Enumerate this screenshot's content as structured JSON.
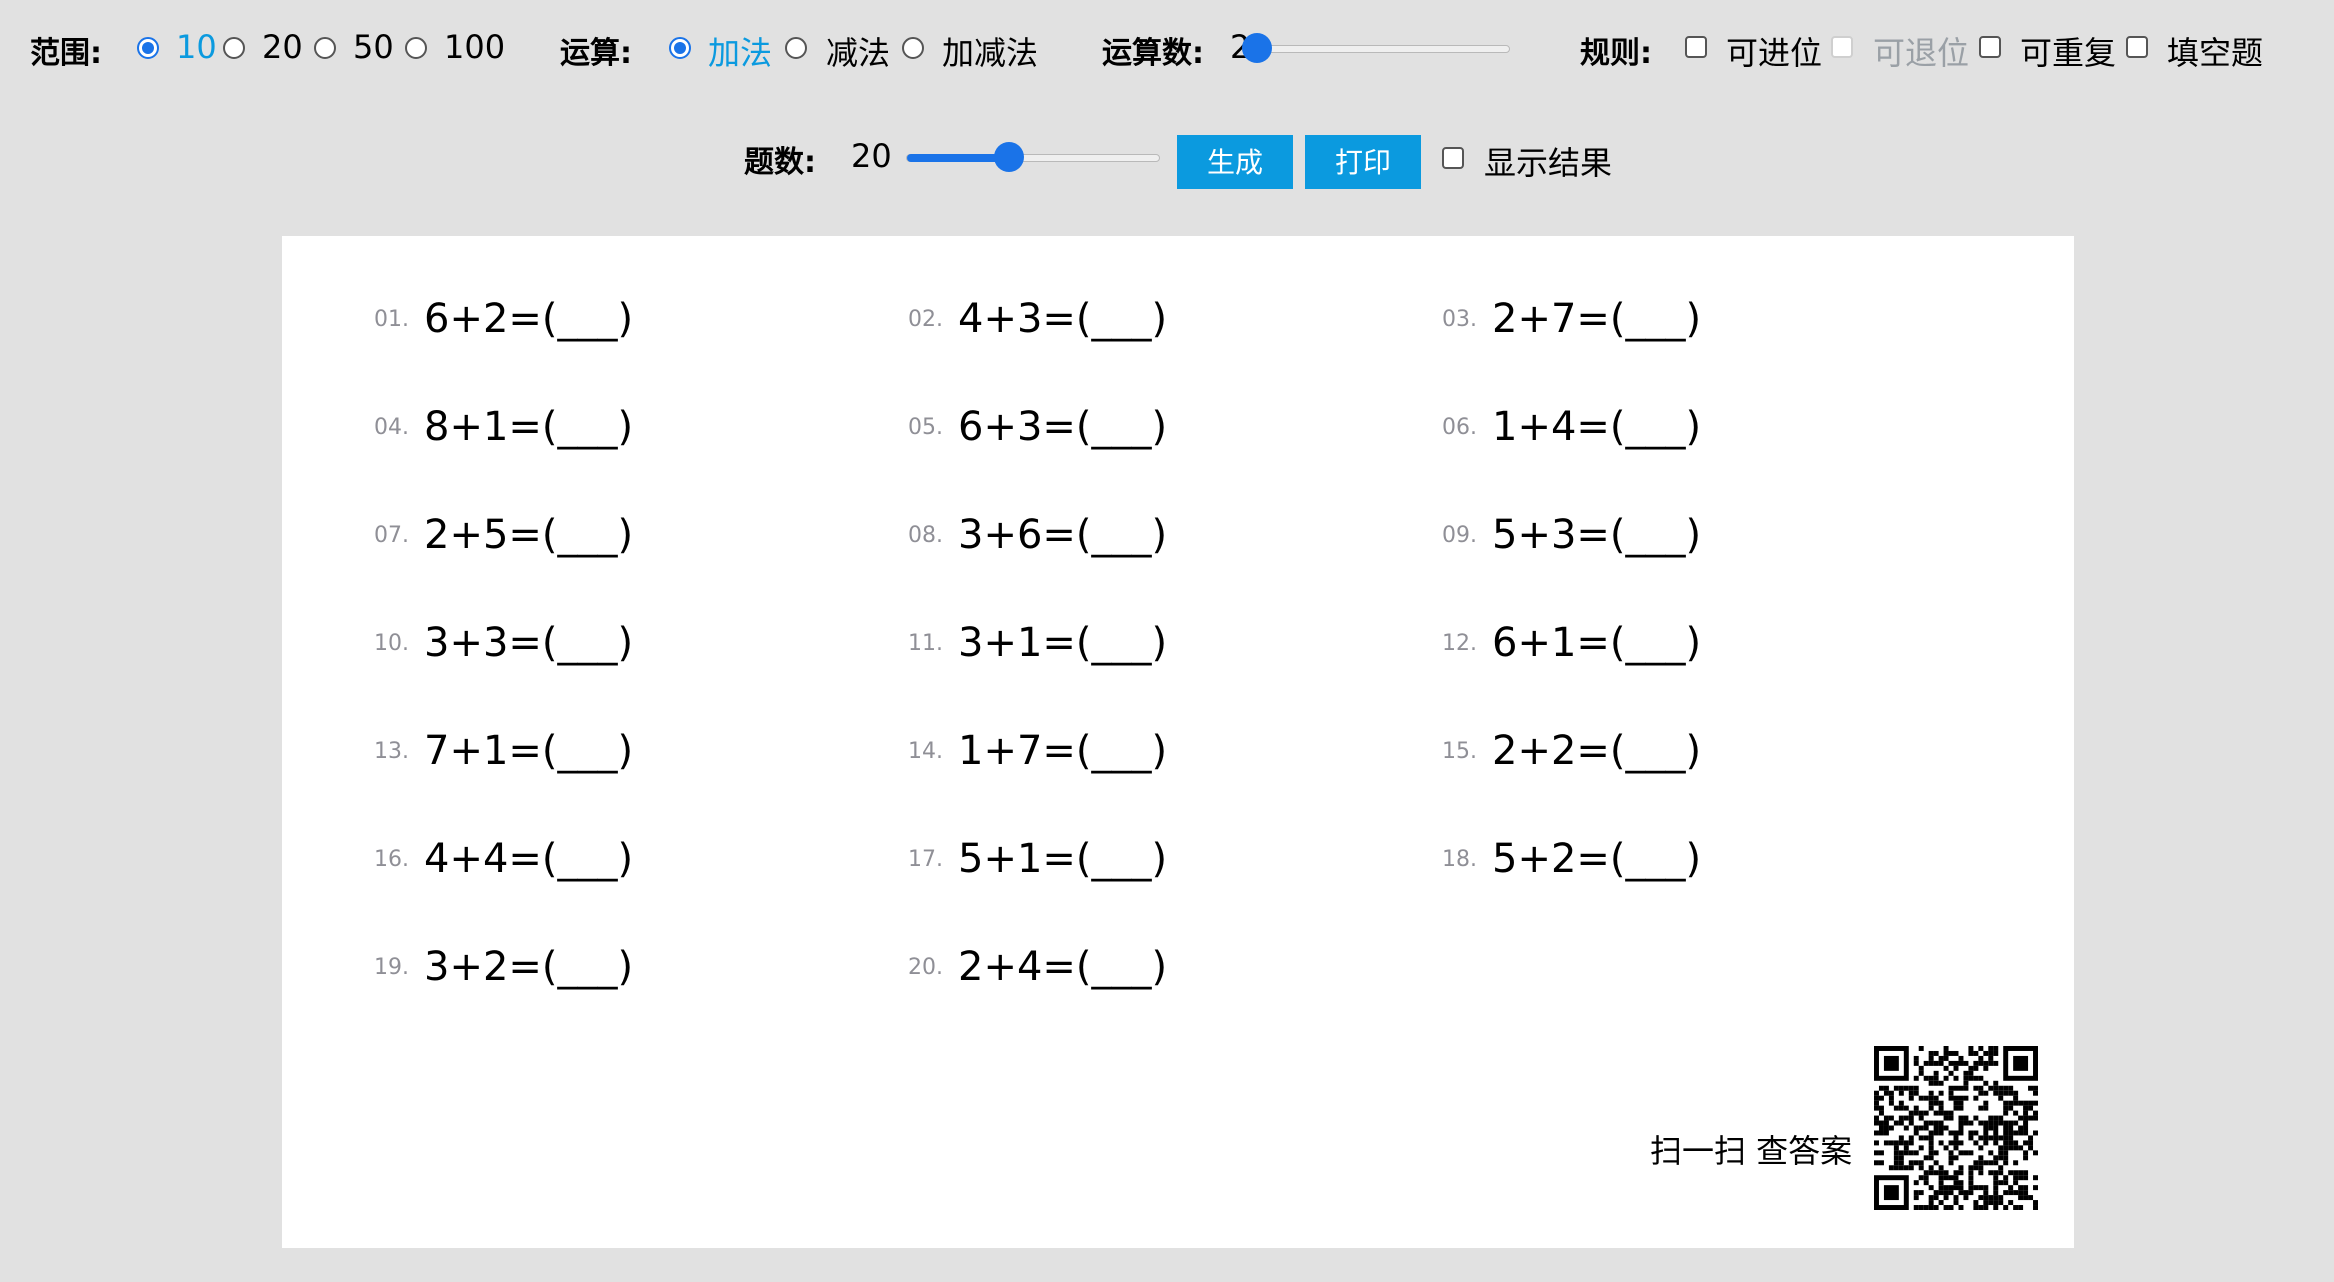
{
  "controls": {
    "range": {
      "label": "范围:",
      "options": [
        "10",
        "20",
        "50",
        "100"
      ],
      "selected": "10"
    },
    "operation": {
      "label": "运算:",
      "options": [
        "加法",
        "减法",
        "加减法"
      ],
      "selected": "加法"
    },
    "operand_count": {
      "label": "运算数:",
      "value": "2",
      "min": 2,
      "max": 10,
      "level": 0
    },
    "rules": {
      "label": "规则:",
      "options": [
        {
          "label": "可进位",
          "checked": false,
          "disabled": false
        },
        {
          "label": "可退位",
          "checked": false,
          "disabled": true
        },
        {
          "label": "可重复",
          "checked": false,
          "disabled": false
        },
        {
          "label": "填空题",
          "checked": false,
          "disabled": false
        }
      ]
    },
    "count": {
      "label": "题数:",
      "value": "20",
      "level": 0.4
    },
    "generate_label": "生成",
    "print_label": "打印",
    "show_results_label": "显示结果"
  },
  "questions": [
    {
      "num": "01.",
      "expr": "6+2=(___)"
    },
    {
      "num": "02.",
      "expr": "4+3=(___)"
    },
    {
      "num": "03.",
      "expr": "2+7=(___)"
    },
    {
      "num": "04.",
      "expr": "8+1=(___)"
    },
    {
      "num": "05.",
      "expr": "6+3=(___)"
    },
    {
      "num": "06.",
      "expr": "1+4=(___)"
    },
    {
      "num": "07.",
      "expr": "2+5=(___)"
    },
    {
      "num": "08.",
      "expr": "3+6=(___)"
    },
    {
      "num": "09.",
      "expr": "5+3=(___)"
    },
    {
      "num": "10.",
      "expr": "3+3=(___)"
    },
    {
      "num": "11.",
      "expr": "3+1=(___)"
    },
    {
      "num": "12.",
      "expr": "6+1=(___)"
    },
    {
      "num": "13.",
      "expr": "7+1=(___)"
    },
    {
      "num": "14.",
      "expr": "1+7=(___)"
    },
    {
      "num": "15.",
      "expr": "2+2=(___)"
    },
    {
      "num": "16.",
      "expr": "4+4=(___)"
    },
    {
      "num": "17.",
      "expr": "5+1=(___)"
    },
    {
      "num": "18.",
      "expr": "5+2=(___)"
    },
    {
      "num": "19.",
      "expr": "3+2=(___)"
    },
    {
      "num": "20.",
      "expr": "2+4=(___)"
    }
  ],
  "qr_label": "扫一扫 查答案",
  "colors": {
    "accent": "#0b9adf",
    "slider": "#1a73e8",
    "background": "#e1e1e1",
    "sheet": "#ffffff"
  }
}
